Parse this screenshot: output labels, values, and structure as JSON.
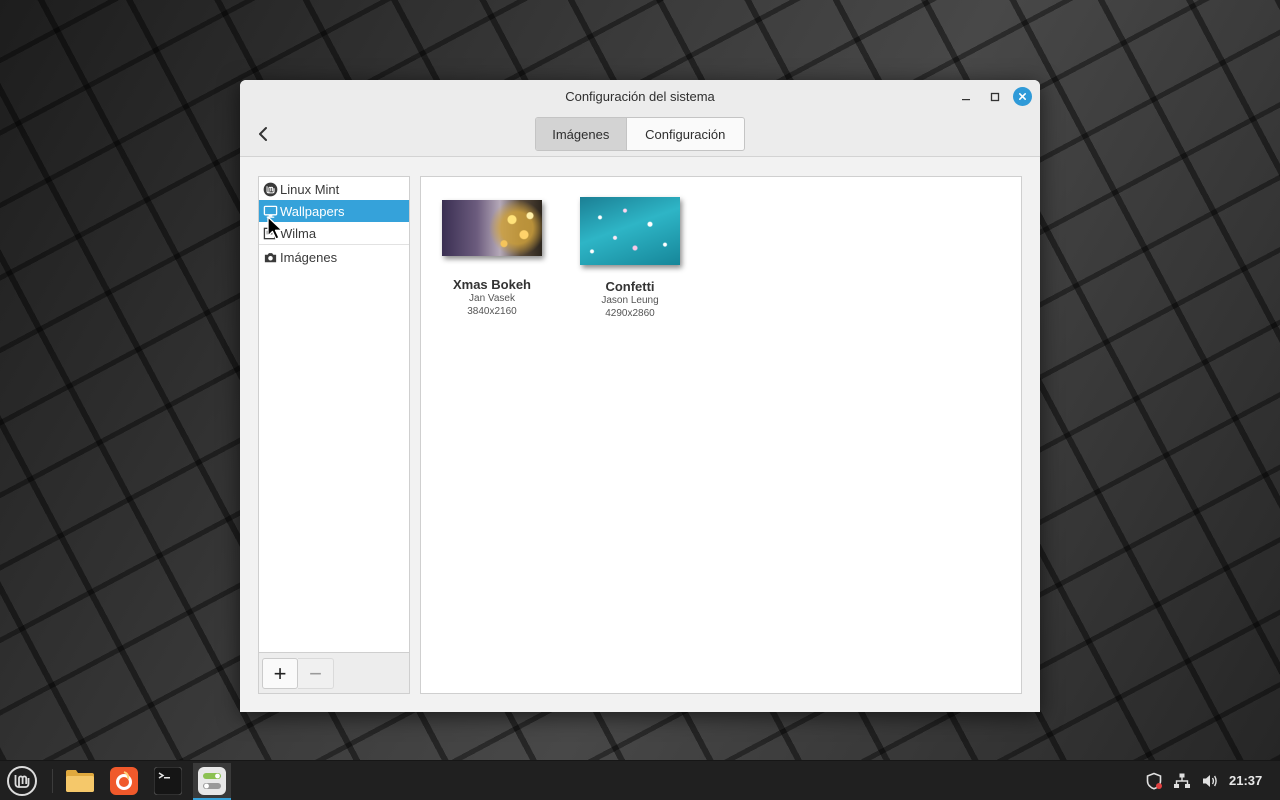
{
  "window": {
    "title": "Configuración del sistema",
    "tabs": [
      {
        "label": "Imágenes",
        "active": true
      },
      {
        "label": "Configuración",
        "active": false
      }
    ]
  },
  "sidebar": {
    "items": [
      {
        "label": "Linux Mint",
        "icon": "linux-mint-logo-icon"
      },
      {
        "label": "Wallpapers",
        "icon": "monitor-icon",
        "selected": true
      },
      {
        "label": "Wilma",
        "icon": "folder-icon"
      },
      {
        "label": "Imágenes",
        "icon": "camera-icon"
      }
    ],
    "add_label": "+",
    "remove_label": "−"
  },
  "wallpapers": [
    {
      "name": "Xmas Bokeh",
      "author": "Jan Vasek",
      "resolution": "3840x2160"
    },
    {
      "name": "Confetti",
      "author": "Jason Leung",
      "resolution": "4290x2860"
    }
  ],
  "taskbar": {
    "clock": "21:37",
    "apps": [
      "menu-icon",
      "files-icon",
      "firefox-icon",
      "terminal-icon",
      "settings-icon"
    ]
  },
  "colors": {
    "accent": "#35a2da",
    "close_button": "#2f9ad8",
    "taskbar": "#202020"
  }
}
